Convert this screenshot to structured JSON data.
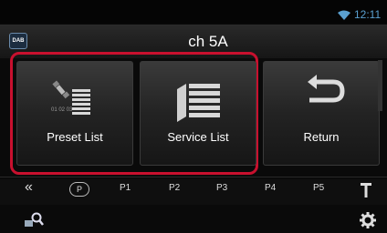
{
  "status": {
    "time": "12:11",
    "wifi_icon": "wifi-icon"
  },
  "header": {
    "source_badge": "DAB",
    "channel": "ch 5A"
  },
  "buttons": {
    "preset_list": "Preset List",
    "service_list": "Service List",
    "return": "Return"
  },
  "presets": {
    "back": "«",
    "p_badge": "P",
    "items": [
      "P1",
      "P2",
      "P3",
      "P4",
      "P5"
    ]
  },
  "colors": {
    "highlight": "#c8102e",
    "clock": "#5aa0d0"
  }
}
